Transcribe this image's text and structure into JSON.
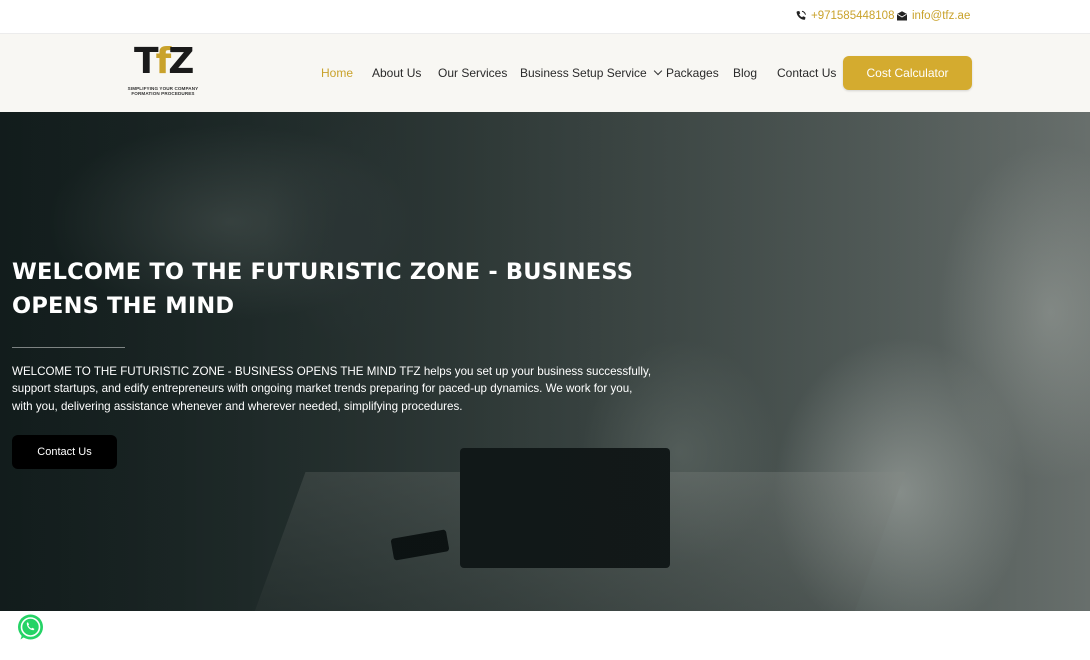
{
  "topbar": {
    "phone": "+971585448108",
    "email": "info@tfz.ae"
  },
  "logo": {
    "mark_left": "T",
    "mark_mid": "f",
    "mark_right": "Z",
    "tagline_1": "SIMPLIFYING YOUR COMPANY",
    "tagline_2": "FORMATION PROCEDURES"
  },
  "nav": {
    "items": [
      {
        "label": "Home",
        "active": true
      },
      {
        "label": "About Us"
      },
      {
        "label": "Our Services"
      },
      {
        "label": "Business Setup Service",
        "has_dropdown": true
      },
      {
        "label": "Packages"
      },
      {
        "label": "Blog"
      },
      {
        "label": "Contact Us"
      }
    ],
    "cta_label": "Cost Calculator"
  },
  "hero": {
    "title": "WELCOME TO THE FUTURISTIC ZONE - BUSINESS OPENS THE MIND",
    "description": "WELCOME TO THE FUTURISTIC ZONE - BUSINESS OPENS THE MIND TFZ helps you set up your business successfully, support startups, and edify entrepreneurs with ongoing market trends preparing for paced-up dynamics. We work for you, with you, delivering assistance whenever and wherever needed, simplifying procedures.",
    "button_label": "Contact Us"
  },
  "colors": {
    "accent": "#d4ab2f",
    "accent_text": "#c9a22b",
    "header_bg": "#f8f7f3",
    "button_dark": "#000000",
    "whatsapp": "#25d366"
  },
  "icons": [
    "phone-icon",
    "envelope-icon",
    "chevron-down-icon",
    "whatsapp-icon"
  ]
}
